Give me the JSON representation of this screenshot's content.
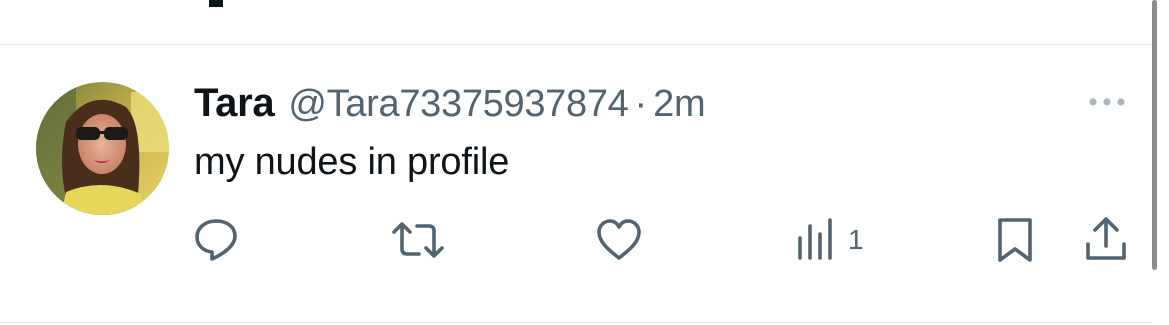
{
  "tweet": {
    "display_name": "Tara",
    "handle": "@Tara73375937874",
    "separator": "·",
    "timestamp": "2m",
    "text": "my nudes in profile",
    "more_icon": "more-horizontal-icon",
    "avatar_icon": "profile-photo"
  },
  "actions": {
    "reply": {
      "icon": "reply-icon"
    },
    "retweet": {
      "icon": "retweet-icon"
    },
    "like": {
      "icon": "heart-icon"
    },
    "views": {
      "icon": "views-chart-icon",
      "count": "1"
    },
    "bookmark": {
      "icon": "bookmark-icon"
    },
    "share": {
      "icon": "share-icon"
    }
  },
  "colors": {
    "primary_text": "#0f1419",
    "secondary_text": "#536471",
    "divider": "#e4e8eb",
    "icon_gray": "#536471"
  }
}
